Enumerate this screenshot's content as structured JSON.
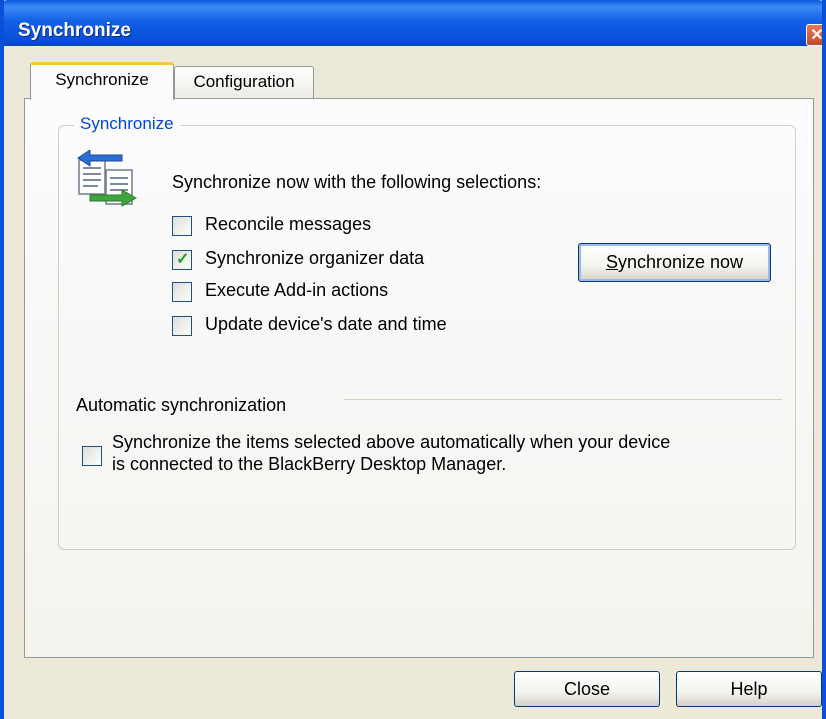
{
  "window": {
    "title": "Synchronize",
    "close_glyph": "✕"
  },
  "tabs": [
    {
      "label": "Synchronize",
      "active": true
    },
    {
      "label": "Configuration",
      "active": false
    }
  ],
  "sync_group": {
    "legend": "Synchronize",
    "icon": "synchronize-icon",
    "intro": "Synchronize now with the following selections:",
    "options": [
      {
        "label": "Reconcile messages",
        "checked": false
      },
      {
        "label": "Synchronize organizer data",
        "checked": true
      },
      {
        "label": "Execute Add-in actions",
        "checked": false
      },
      {
        "label": "Update device's date and time",
        "checked": false
      }
    ],
    "sync_button": {
      "mnemonic": "S",
      "rest": "ynchronize now"
    }
  },
  "auto_sync": {
    "heading": "Automatic synchronization",
    "checked": false,
    "line1": "Synchronize the items selected above automatically when your device",
    "line2": "is connected to the BlackBerry Desktop Manager."
  },
  "footer": {
    "close_label": "Close",
    "help_label": "Help"
  },
  "colors": {
    "title_bar": "#0a4fd8",
    "group_legend": "#0046d5",
    "check": "#21a121",
    "tab_highlight": "#ffc83c"
  }
}
